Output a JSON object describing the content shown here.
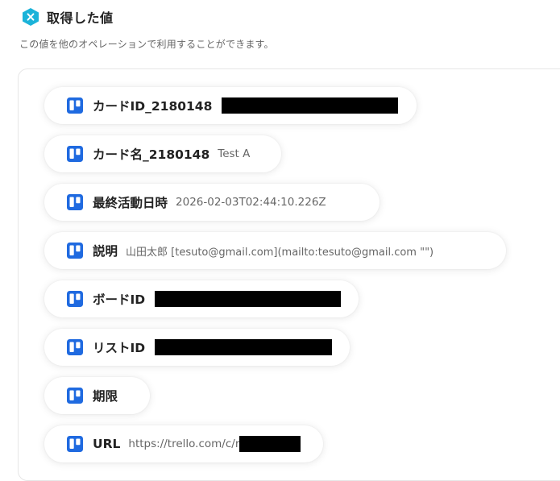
{
  "header": {
    "title": "取得した値",
    "icon": "yoom-hex-icon",
    "icon_color": "#1bb3d9",
    "subtitle": "この値を他のオペレーションで利用することができます。"
  },
  "icon": "trello-icon",
  "icon_color": "#1f6ae0",
  "items": [
    {
      "label": "カードID_2180148",
      "value": "",
      "redacted": true
    },
    {
      "label": "カード名_2180148",
      "value": "Test A",
      "redacted": false
    },
    {
      "label": "最終活動日時",
      "value": "2026-02-03T02:44:10.226Z",
      "redacted": false
    },
    {
      "label": "説明",
      "value": "山田太郎 [tesuto@gmail.com](mailto:tesuto@gmail.com \"\")",
      "redacted": false
    },
    {
      "label": "ボードID",
      "value": "",
      "redacted": true
    },
    {
      "label": "リストID",
      "value": "",
      "redacted": true
    },
    {
      "label": "期限",
      "value": "",
      "redacted": false
    },
    {
      "label": "URL",
      "value": "https://trello.com/c/r",
      "redacted": true
    }
  ]
}
